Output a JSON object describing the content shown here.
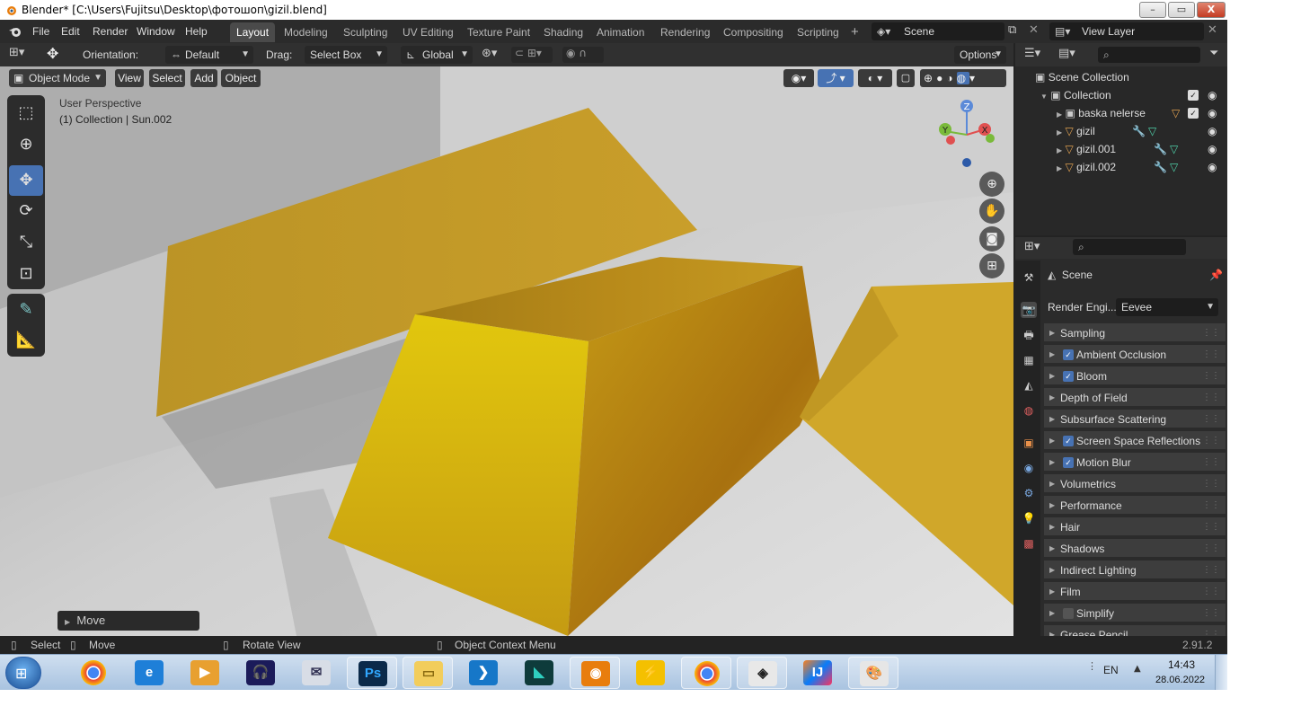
{
  "window": {
    "title": "Blender* [C:\\Users\\Fujitsu\\Desktop\\фотошоп\\gizil.blend]",
    "minimize": "–",
    "maximize": "▭",
    "close": "X"
  },
  "menu": [
    "File",
    "Edit",
    "Render",
    "Window",
    "Help"
  ],
  "workspaces": [
    {
      "label": "Layout",
      "active": true
    },
    {
      "label": "Modeling"
    },
    {
      "label": "Sculpting"
    },
    {
      "label": "UV Editing"
    },
    {
      "label": "Texture Paint"
    },
    {
      "label": "Shading"
    },
    {
      "label": "Animation"
    },
    {
      "label": "Rendering"
    },
    {
      "label": "Compositing"
    },
    {
      "label": "Scripting"
    }
  ],
  "add_workspace": "+",
  "scene": "Scene",
  "view_layer": "View Layer",
  "header": {
    "orientation_label": "Orientation:",
    "orientation_value": "Default",
    "drag_label": "Drag:",
    "drag_value": "Select Box",
    "transform_orientation": "Global",
    "options": "Options"
  },
  "viewport": {
    "mode": "Object Mode",
    "menus": [
      "View",
      "Select",
      "Add",
      "Object"
    ],
    "perspective": "User Perspective",
    "collection_info": "(1) Collection | Sun.002",
    "last_op": "Move",
    "gizmo": {
      "z": "Z",
      "y": "Y",
      "x": "X"
    }
  },
  "outliner": {
    "root": "Scene Collection",
    "collection": "Collection",
    "items": [
      "baska nelerse",
      "gizil",
      "gizil.001",
      "gizil.002"
    ]
  },
  "properties": {
    "context": "Scene",
    "render_engine_label": "Render Engi...",
    "render_engine": "Eevee",
    "panels": [
      {
        "label": "Sampling"
      },
      {
        "label": "Ambient Occlusion",
        "checked": true
      },
      {
        "label": "Bloom",
        "checked": true
      },
      {
        "label": "Depth of Field"
      },
      {
        "label": "Subsurface Scattering"
      },
      {
        "label": "Screen Space Reflections",
        "checked": true
      },
      {
        "label": "Motion Blur",
        "checked": true
      },
      {
        "label": "Volumetrics"
      },
      {
        "label": "Performance"
      },
      {
        "label": "Hair"
      },
      {
        "label": "Shadows"
      },
      {
        "label": "Indirect Lighting"
      },
      {
        "label": "Film"
      },
      {
        "label": "Simplify",
        "checked": false
      },
      {
        "label": "Grease Pencil"
      }
    ]
  },
  "status": {
    "select": "Select",
    "move": "Move",
    "rotate": "Rotate View",
    "context_menu": "Object Context Menu",
    "version": "2.91.2"
  },
  "taskbar": {
    "lang": "EN",
    "time": "14:43",
    "date": "28.06.2022",
    "apps": [
      "chrome-icon",
      "ie-icon",
      "media-player-icon",
      "audacity-icon",
      "mail-icon",
      "ps",
      "explorer-icon",
      "vscode-icon",
      "game-icon",
      "blender-icon",
      "stripes-icon",
      "chrome-icon",
      "unity-icon",
      "ij",
      "paint-icon"
    ],
    "ps_label": "Ps",
    "ij_label": "IJ"
  }
}
